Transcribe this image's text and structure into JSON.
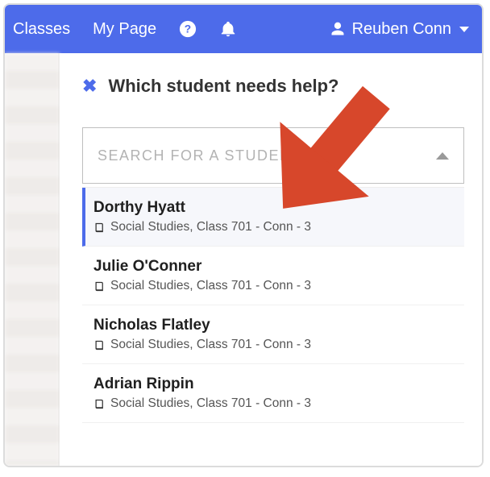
{
  "nav": {
    "classes": "Classes",
    "mypage": "My Page",
    "user_name": "Reuben Conn"
  },
  "modal": {
    "title": "Which student needs help?"
  },
  "search": {
    "placeholder": "Search for a student",
    "value": ""
  },
  "students": [
    {
      "name": "Dorthy Hyatt",
      "class": "Social Studies, Class 701 - Conn - 3"
    },
    {
      "name": "Julie O'Conner",
      "class": "Social Studies, Class 701 - Conn - 3"
    },
    {
      "name": "Nicholas Flatley",
      "class": "Social Studies, Class 701 - Conn - 3"
    },
    {
      "name": "Adrian Rippin",
      "class": "Social Studies, Class 701 - Conn - 3"
    }
  ],
  "colors": {
    "brand": "#4d6bea",
    "annotation": "#d7472b"
  }
}
